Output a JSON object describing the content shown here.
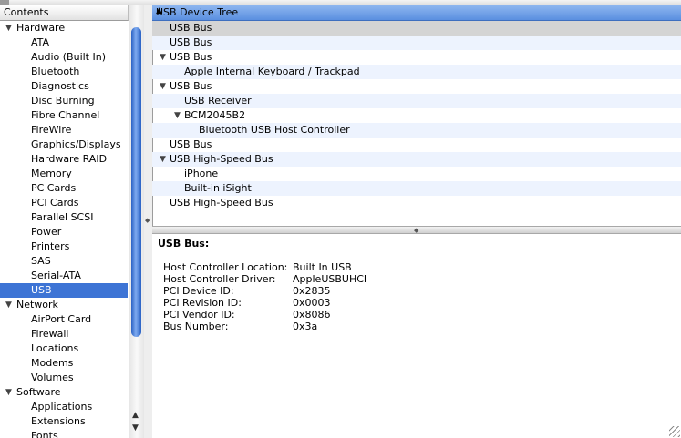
{
  "left_pane": {
    "header": "Contents",
    "items": [
      {
        "label": "Hardware",
        "level": 0,
        "expandable": true
      },
      {
        "label": "ATA",
        "level": 1
      },
      {
        "label": "Audio (Built In)",
        "level": 1
      },
      {
        "label": "Bluetooth",
        "level": 1
      },
      {
        "label": "Diagnostics",
        "level": 1
      },
      {
        "label": "Disc Burning",
        "level": 1
      },
      {
        "label": "Fibre Channel",
        "level": 1
      },
      {
        "label": "FireWire",
        "level": 1
      },
      {
        "label": "Graphics/Displays",
        "level": 1
      },
      {
        "label": "Hardware RAID",
        "level": 1
      },
      {
        "label": "Memory",
        "level": 1
      },
      {
        "label": "PC Cards",
        "level": 1
      },
      {
        "label": "PCI Cards",
        "level": 1
      },
      {
        "label": "Parallel SCSI",
        "level": 1
      },
      {
        "label": "Power",
        "level": 1
      },
      {
        "label": "Printers",
        "level": 1
      },
      {
        "label": "SAS",
        "level": 1
      },
      {
        "label": "Serial-ATA",
        "level": 1
      },
      {
        "label": "USB",
        "level": 1,
        "selected": true
      },
      {
        "label": "Network",
        "level": 0,
        "expandable": true
      },
      {
        "label": "AirPort Card",
        "level": 1
      },
      {
        "label": "Firewall",
        "level": 1
      },
      {
        "label": "Locations",
        "level": 1
      },
      {
        "label": "Modems",
        "level": 1
      },
      {
        "label": "Volumes",
        "level": 1
      },
      {
        "label": "Software",
        "level": 0,
        "expandable": true
      },
      {
        "label": "Applications",
        "level": 1
      },
      {
        "label": "Extensions",
        "level": 1
      },
      {
        "label": "Fonts",
        "level": 1
      }
    ]
  },
  "device_tree": {
    "header": "USB Device Tree",
    "items": [
      {
        "label": "USB Bus",
        "level": 0,
        "selected": true
      },
      {
        "label": "USB Bus",
        "level": 0
      },
      {
        "label": "USB Bus",
        "level": 0,
        "expandable": true
      },
      {
        "label": "Apple Internal Keyboard / Trackpad",
        "level": 1
      },
      {
        "label": "USB Bus",
        "level": 0,
        "expandable": true
      },
      {
        "label": "USB Receiver",
        "level": 1
      },
      {
        "label": "BCM2045B2",
        "level": 1,
        "expandable": true
      },
      {
        "label": "Bluetooth USB Host Controller",
        "level": 2
      },
      {
        "label": "USB Bus",
        "level": 0
      },
      {
        "label": "USB High-Speed Bus",
        "level": 0,
        "expandable": true
      },
      {
        "label": "iPhone",
        "level": 1
      },
      {
        "label": "Built-in iSight",
        "level": 1
      },
      {
        "label": "USB High-Speed Bus",
        "level": 0
      }
    ]
  },
  "detail": {
    "title": "USB Bus:",
    "rows": [
      {
        "key": "Host Controller Location:",
        "value": "Built In USB"
      },
      {
        "key": "Host Controller Driver:",
        "value": "AppleUSBUHCI"
      },
      {
        "key": "PCI Device ID:",
        "value": "0x2835"
      },
      {
        "key": "PCI Revision ID:",
        "value": "0x0003"
      },
      {
        "key": "PCI Vendor ID:",
        "value": "0x8086"
      },
      {
        "key": "Bus Number:",
        "value": "0x3a"
      }
    ]
  },
  "colors": {
    "selection": "#3d74d5",
    "header_blue": "#6d9de6",
    "row_alt": "#edf3fe",
    "row_selected": "#d4d4d4"
  }
}
